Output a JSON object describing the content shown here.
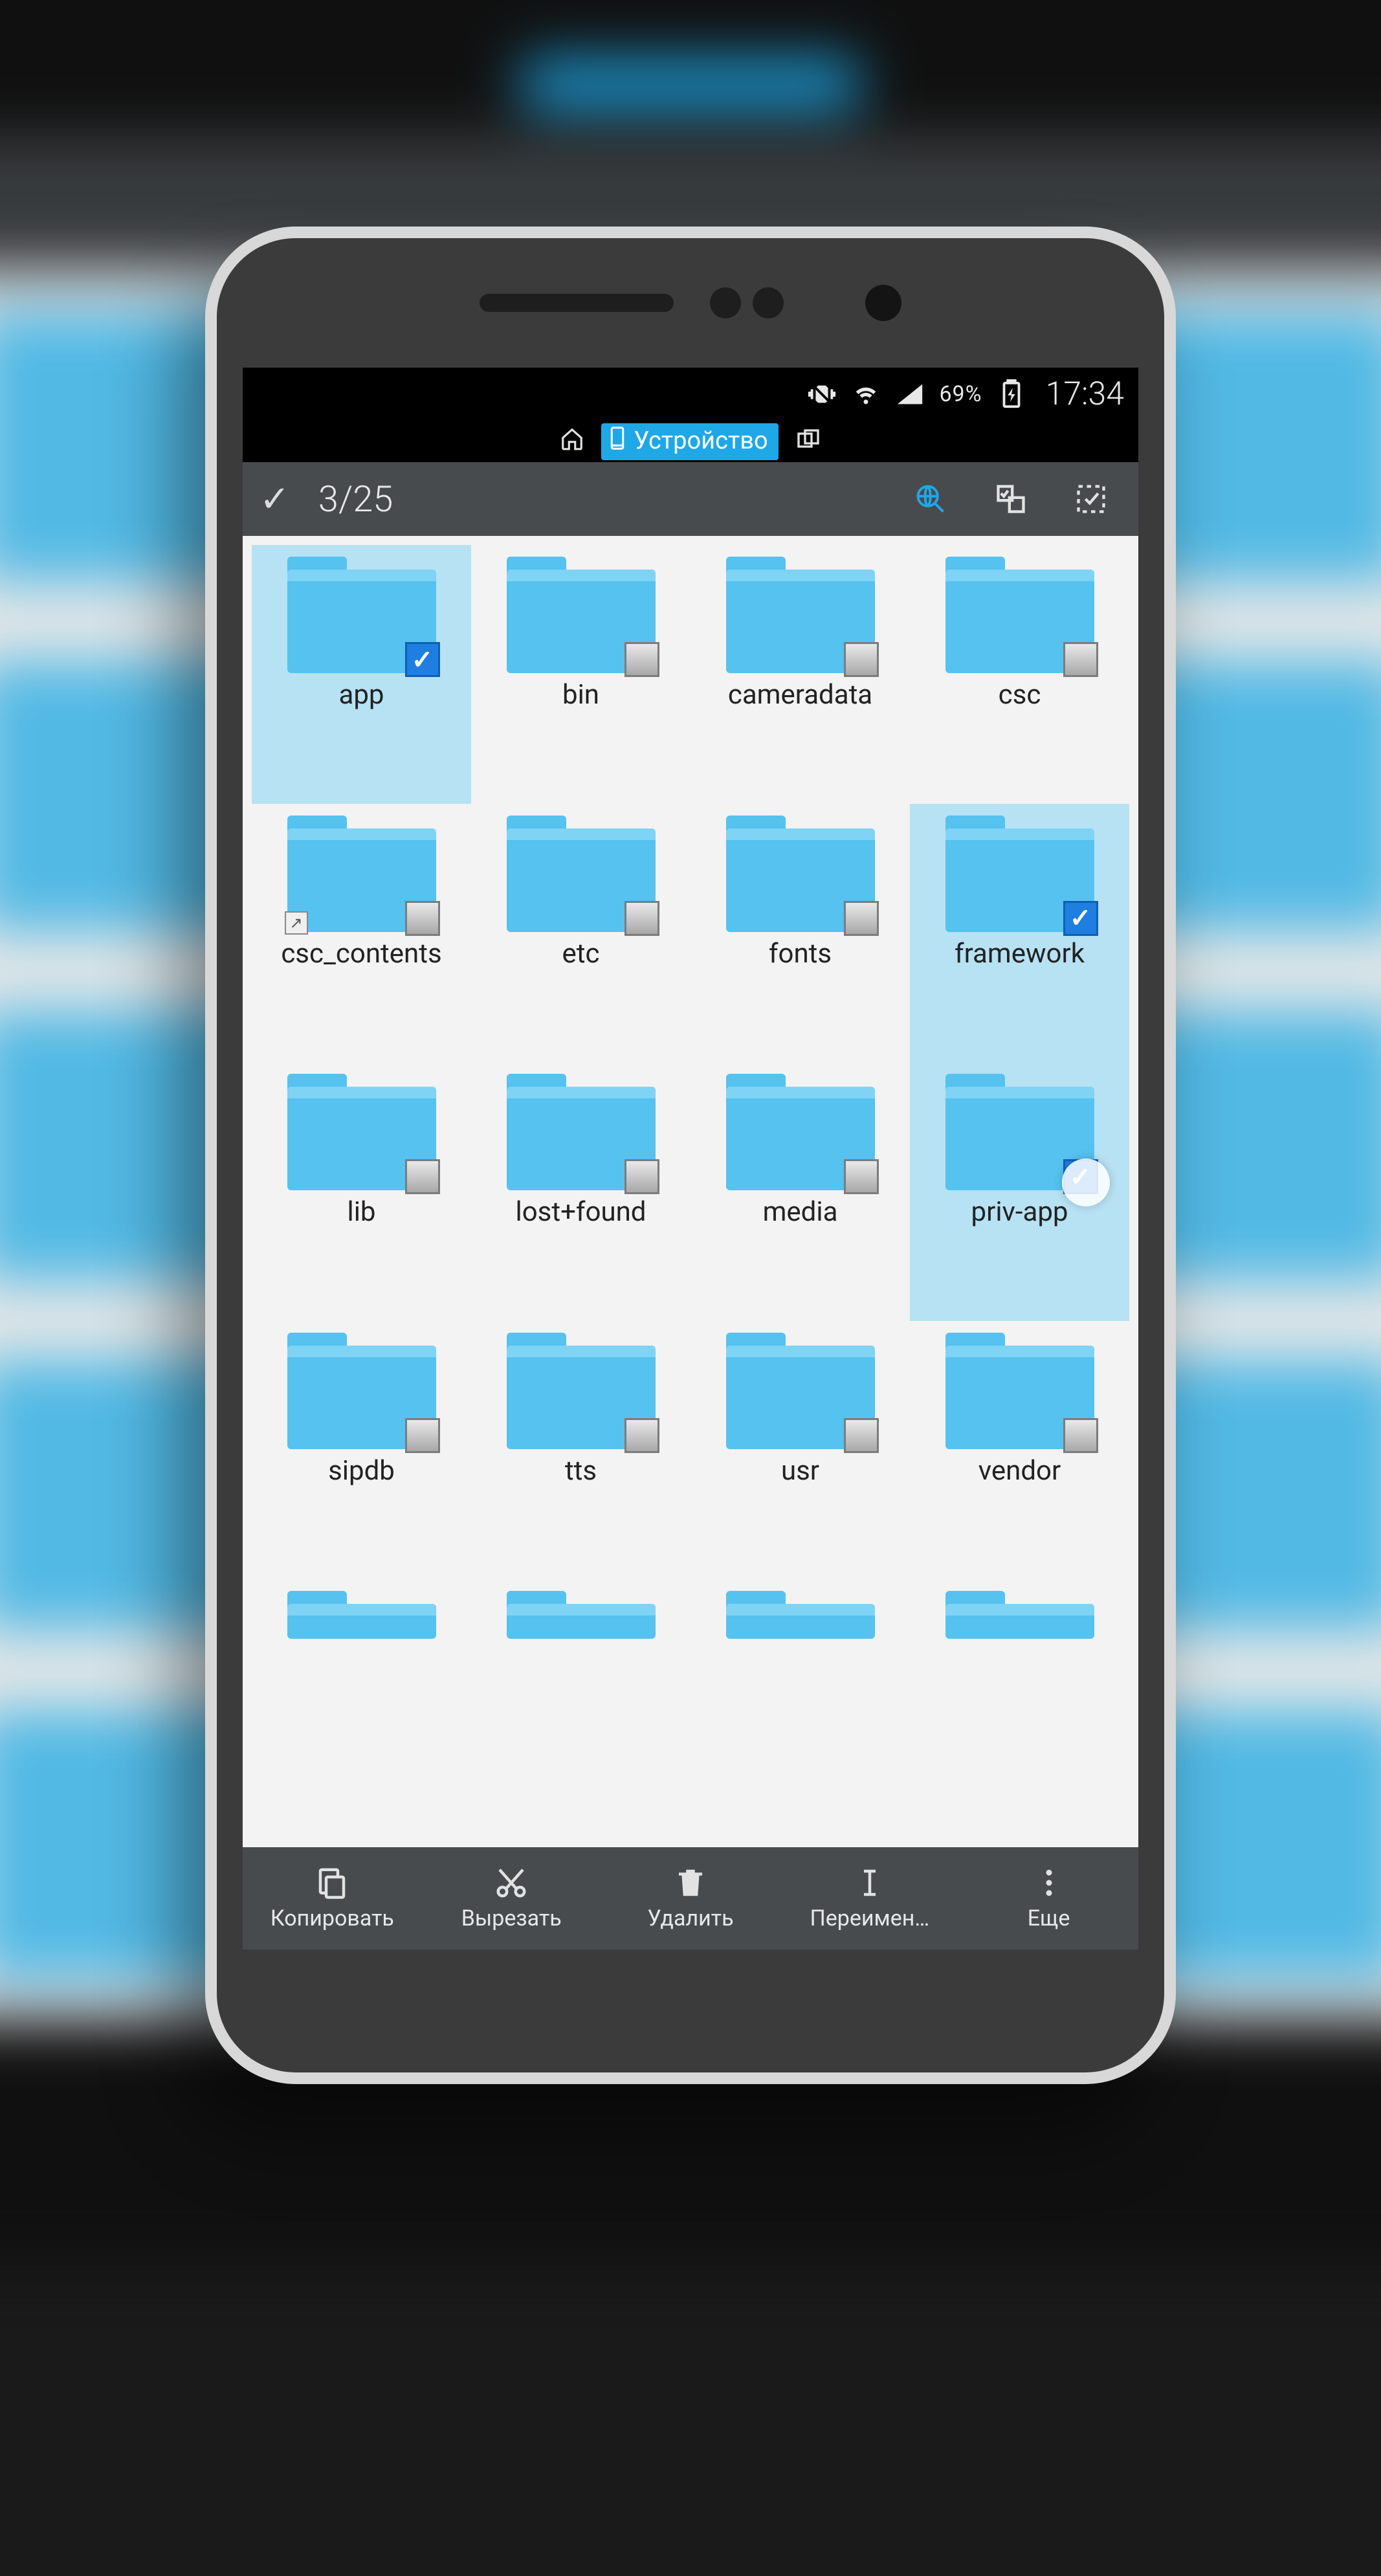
{
  "status": {
    "battery": "69%",
    "time": "17:34"
  },
  "tabs": {
    "active_label": "Устройство"
  },
  "actionbar": {
    "selection_count": "3/25"
  },
  "folders": [
    {
      "name": "app",
      "selected": true,
      "shortcut": false
    },
    {
      "name": "bin",
      "selected": false,
      "shortcut": false
    },
    {
      "name": "cameradata",
      "selected": false,
      "shortcut": false
    },
    {
      "name": "csc",
      "selected": false,
      "shortcut": false
    },
    {
      "name": "csc_contents",
      "selected": false,
      "shortcut": true
    },
    {
      "name": "etc",
      "selected": false,
      "shortcut": false
    },
    {
      "name": "fonts",
      "selected": false,
      "shortcut": false
    },
    {
      "name": "framework",
      "selected": true,
      "shortcut": false
    },
    {
      "name": "lib",
      "selected": false,
      "shortcut": false
    },
    {
      "name": "lost+found",
      "selected": false,
      "shortcut": false
    },
    {
      "name": "media",
      "selected": false,
      "shortcut": false
    },
    {
      "name": "priv-app",
      "selected": true,
      "shortcut": false
    },
    {
      "name": "sipdb",
      "selected": false,
      "shortcut": false
    },
    {
      "name": "tts",
      "selected": false,
      "shortcut": false
    },
    {
      "name": "usr",
      "selected": false,
      "shortcut": false
    },
    {
      "name": "vendor",
      "selected": false,
      "shortcut": false
    }
  ],
  "bottombar": {
    "copy": "Копировать",
    "cut": "Вырезать",
    "delete": "Удалить",
    "rename": "Переимен…",
    "more": "Еще"
  }
}
